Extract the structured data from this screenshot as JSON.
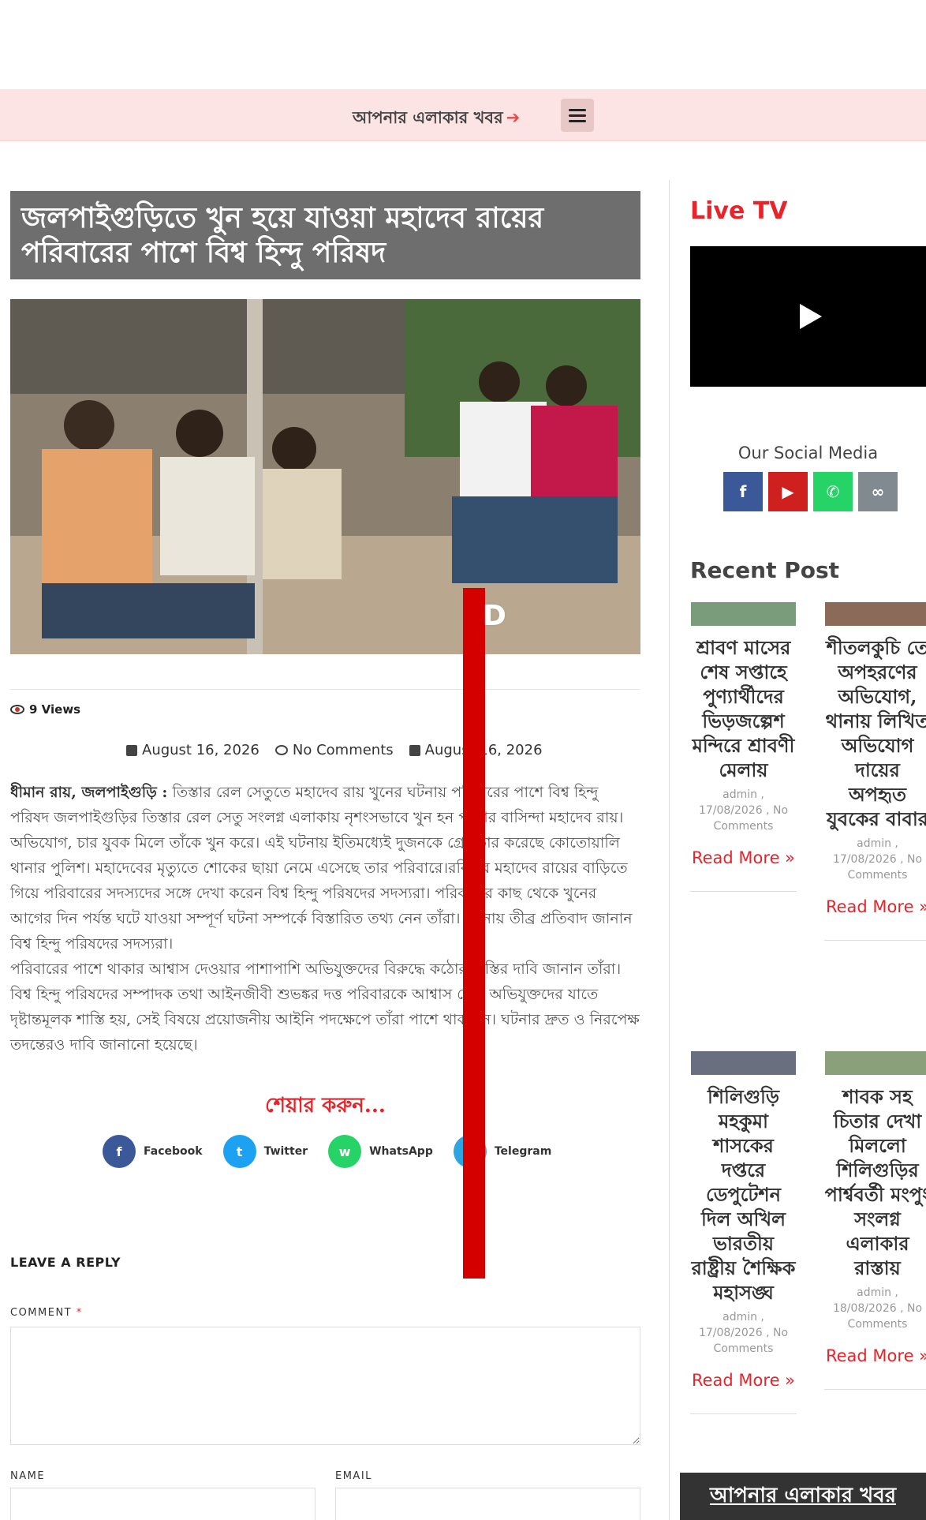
{
  "topbar": {
    "area_link": "আপনার এলাকার খবর",
    "arrow_icon": "arrow-right-icon",
    "menu_icon": "hamburger-icon"
  },
  "article": {
    "title": "জলপাইগুড়িতে খুন হয়ে যাওয়া মহাদেব রায়ের পরিবারের পাশে বিশ্ব হিন্দু পরিষদ",
    "views": "9 Views",
    "date_published": "August 16, 2026",
    "comments": "No Comments",
    "date_modified": "August 16, 2026",
    "byline": "ধীমান রায়, জলপাইগুড়ি :",
    "para1": " তিস্তার রেল সেতুতে মহাদেব রায় খুনের ঘটনায় পরিবারের পাশে বিশ্ব হিন্দু পরিষদ জলপাইগুড়ির তিস্তার রেল সেতু সংলগ্ন এলাকায় নৃশংসভাবে খুন হন পাড়ার বাসিন্দা মহাদেব রায়। অভিযোগ, চার যুবক মিলে তাঁকে খুন করে। এই ঘটনায় ইতিমধ্যেই দুজনকে গ্রেফতার করেছে কোতোয়ালি থানার পুলিশ। মহাদেবের মৃত্যুতে শোকের ছায়া নেমে এসেছে তার পরিবারে।রবিবার মহাদেব রায়ের বাড়িতে গিয়ে পরিবারের সদস্যদের সঙ্গে দেখা করেন বিশ্ব হিন্দু পরিষদের সদস্যরা। পরিবারের কাছ থেকে খুনের আগের দিন পর্যন্ত ঘটে যাওয়া সম্পূর্ণ ঘটনা সম্পর্কে বিস্তারিত তথ্য নেন তাঁরা। ঘটনায় তীব্র প্রতিবাদ জানান বিশ্ব হিন্দু পরিষদের সদস্যরা।",
    "para2": "পরিবারের পাশে থাকার আশ্বাস দেওয়ার পাশাপাশি অভিযুক্তদের বিরুদ্ধে কঠোর শাস্তির দাবি জানান তাঁরা। বিশ্ব হিন্দু পরিষদের সম্পাদক তথা আইনজীবী শুভঙ্কর দত্ত পরিবারকে আশ্বাস দেন, অভিযুক্তদের যাতে দৃষ্টান্তমূলক শাস্তি হয়, সেই বিষয়ে প্রয়োজনীয় আইনি পদক্ষেপে তাঁরা পাশে থাকবেন। ঘটনার দ্রুত ও নিরপেক্ষ তদন্তেরও দাবি জানানো হয়েছে।"
  },
  "share": {
    "title": "শেয়ার করুন...",
    "facebook": "Facebook",
    "twitter": "Twitter",
    "whatsapp": "WhatsApp",
    "telegram": "Telegram"
  },
  "reply": {
    "heading": "LEAVE A REPLY",
    "comment_label": "COMMENT",
    "required_mark": "*",
    "name_label": "NAME",
    "email_label": "EMAIL"
  },
  "overlay": {
    "letter": "D",
    "color": "#d40000"
  },
  "sidebar": {
    "live_tv": "Live TV",
    "social_title": "Our Social Media",
    "social_icons": [
      "facebook-icon",
      "youtube-icon",
      "whatsapp-icon",
      "link-icon"
    ],
    "recent_title": "Recent Post",
    "posts": [
      {
        "title": "শ্রাবণ মাসের শেষ সপ্তাহে পুণ্যার্থীদের ভিড়জল্পেশ মন্দিরে শ্রাবণী মেলায়",
        "meta": "admin , 17/08/2026 , No Comments",
        "read_more": "Read More »"
      },
      {
        "title": "শীতলকুচি তে অপহরণের অভিযোগ, থানায় লিখিত অভিযোগ দায়ের অপহৃত যুবকের বাবার",
        "meta": "admin , 17/08/2026 , No Comments",
        "read_more": "Read More »"
      },
      {
        "title": "শিলিগুড়ি মহকুমা শাসকের দপ্তরে ডেপুটেশন দিল অখিল ভারতীয় রাষ্ট্রীয় শৈক্ষিক মহাসঙ্ঘ",
        "meta": "admin , 17/08/2026 , No Comments",
        "read_more": "Read More »"
      },
      {
        "title": "শাবক সহ চিতার দেখা মিললো শিলিগুড়ির পার্শ্ববর্তী মংপুং সংলগ্ন এলাকার রাস্তায়",
        "meta": "admin , 18/08/2026 , No Comments",
        "read_more": "Read More »"
      }
    ],
    "bottom_banner": "আপনার এলাকার খবর"
  },
  "colors": {
    "accent_red": "#e8232a",
    "topbar_bg": "#fde4e4",
    "title_bg": "#6e6e6e"
  }
}
